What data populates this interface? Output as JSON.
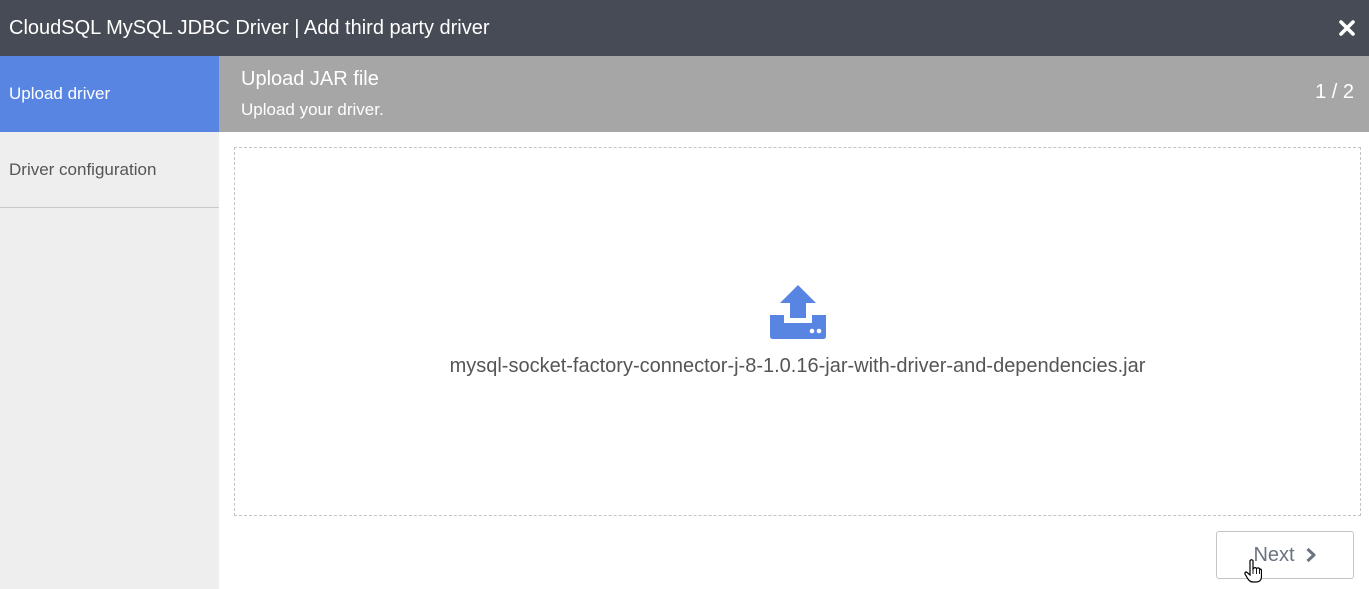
{
  "window": {
    "title": "CloudSQL MySQL JDBC Driver | Add third party driver",
    "close_icon": "close-icon"
  },
  "sidebar": {
    "items": [
      {
        "label": "Upload driver",
        "active": true
      },
      {
        "label": "Driver configuration",
        "active": false
      }
    ]
  },
  "step": {
    "title": "Upload JAR file",
    "subtitle": "Upload your driver.",
    "counter": "1 / 2"
  },
  "dropzone": {
    "icon": "upload-icon",
    "file_name": "mysql-socket-factory-connector-j-8-1.0.16-jar-with-driver-and-dependencies.jar"
  },
  "footer": {
    "next_label": "Next",
    "next_icon": "chevron-right-icon"
  },
  "colors": {
    "titlebar": "#474b55",
    "accent": "#5985e2",
    "step_header": "#a6a6a6",
    "sidebar": "#eeeeee"
  }
}
